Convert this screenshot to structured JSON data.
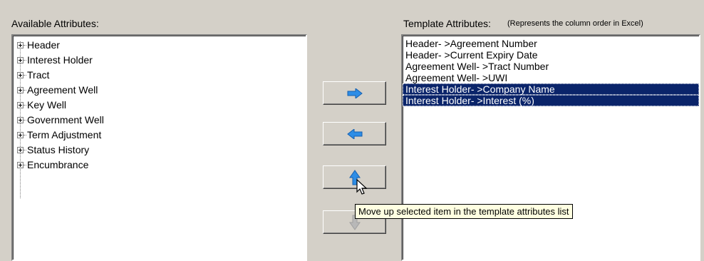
{
  "available": {
    "label": "Available Attributes:",
    "items": [
      "Header",
      "Interest Holder",
      "Tract",
      "Agreement Well",
      "Key Well",
      "Government Well",
      "Term Adjustment",
      "Status History",
      "Encumbrance"
    ]
  },
  "template": {
    "label": "Template Attributes:",
    "note": "(Represents the column order in Excel)",
    "items": [
      {
        "text": "Header- >Agreement Number",
        "selected": false
      },
      {
        "text": "Header- >Current Expiry Date",
        "selected": false
      },
      {
        "text": "Agreement Well- >Tract Number",
        "selected": false
      },
      {
        "text": "Agreement Well- >UWI",
        "selected": false
      },
      {
        "text": "Interest Holder- >Company Name",
        "selected": true
      },
      {
        "text": "Interest Holder- >Interest (%)",
        "selected": true
      }
    ]
  },
  "buttons": {
    "add_icon": "arrow-right-icon",
    "remove_icon": "arrow-left-icon",
    "up_icon": "arrow-up-icon",
    "down_icon": "arrow-down-icon"
  },
  "tooltip": "Move up selected item in the template attributes list",
  "colors": {
    "selection": "#0a246a",
    "arrow": "#2d8de6",
    "disabled_arrow": "#a0a0a0",
    "tooltip_bg": "#ffffe1"
  }
}
